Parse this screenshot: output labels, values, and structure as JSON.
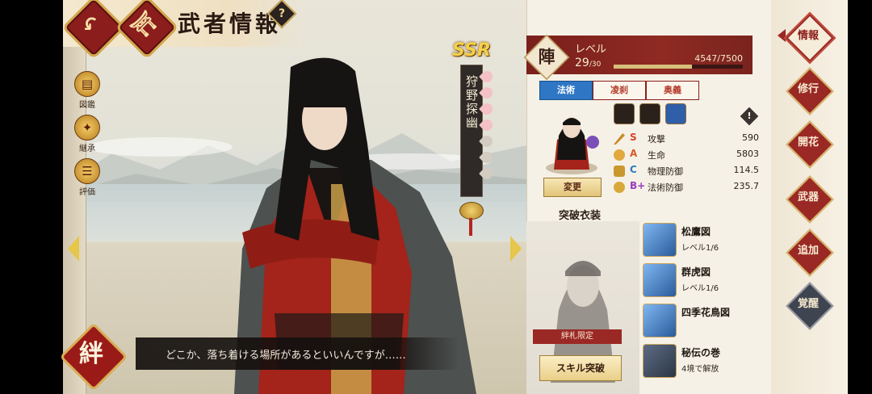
{
  "header": {
    "title": "武者情報",
    "help": "?"
  },
  "top_buttons": {
    "back_glyph": "↶",
    "home_glyph": "⛩"
  },
  "left_icons": [
    {
      "icon": "book-icon",
      "label": "図鑑"
    },
    {
      "icon": "crest-icon",
      "label": "継承"
    },
    {
      "icon": "review-icon",
      "label": "評価"
    }
  ],
  "character": {
    "rarity": "SSR",
    "name": "狩野探幽"
  },
  "dialogue": {
    "kizuna": "絆",
    "text": "どこか、落ち着ける場所があるといいんですが……"
  },
  "level": {
    "badge": "陣",
    "label": "レベル",
    "current": "29",
    "max": "/30",
    "exp_text": "4547/7500",
    "exp_fraction": 0.606
  },
  "tabs": [
    "法術",
    "凌刹",
    "奥義"
  ],
  "change_button": "変更",
  "info_bubble": "!",
  "stats": [
    {
      "icon": "sword-icon",
      "grade": "S",
      "grade_color": "#d9402a",
      "name": "攻撃",
      "value": "590"
    },
    {
      "icon": "heart-flower-icon",
      "grade": "A",
      "grade_color": "#d9582a",
      "name": "生命",
      "value": "5803"
    },
    {
      "icon": "armor-icon",
      "grade": "C",
      "grade_color": "#2a7ac0",
      "name": "物理防御",
      "value": "114.5"
    },
    {
      "icon": "magic-shield-icon",
      "grade": "B+",
      "grade_color": "#9a3ac0",
      "name": "法術防御",
      "value": "235.7"
    }
  ],
  "costume": {
    "section_title": "突破衣装",
    "bond_limited": "絆札限定",
    "skill_break_button": "スキル突破"
  },
  "items": [
    {
      "name": "松鷹図",
      "sub": "レベル1/6"
    },
    {
      "name": "群虎図",
      "sub": "レベル1/6"
    },
    {
      "name": "四季花鳥図",
      "sub": ""
    },
    {
      "name": "秘伝の巻",
      "sub": "4境で解放"
    }
  ],
  "menu": [
    "情報",
    "修行",
    "開花",
    "武器",
    "追加",
    "覚醒"
  ]
}
